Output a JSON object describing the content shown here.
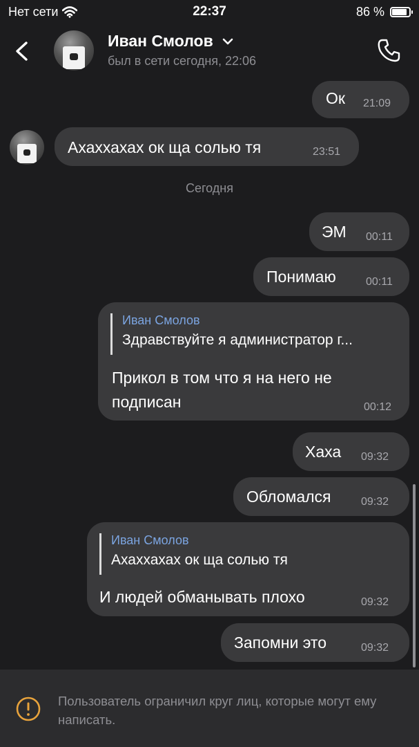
{
  "status_bar": {
    "carrier": "Нет сети",
    "time": "22:37",
    "battery_text": "86 %",
    "battery_level": 0.86,
    "icons": {
      "wifi": "wifi-icon",
      "battery": "battery-icon"
    }
  },
  "header": {
    "name": "Иван Смолов",
    "status": "был в сети сегодня, 22:06",
    "icons": {
      "back": "chevron-left-icon",
      "expand": "chevron-down-icon",
      "call": "phone-icon"
    }
  },
  "messages": [
    {
      "text": "Ок",
      "time": "21:09"
    },
    {
      "text": "Ахаххахах ок ща солью тя",
      "time": "23:51"
    },
    {
      "text": "ЭМ",
      "time": "00:11"
    },
    {
      "text": "Понимаю",
      "time": "00:11"
    },
    {
      "reply_name": "Иван Смолов",
      "reply_text": "Здравствуйте я администратор г...",
      "line1": "Прикол в том что я на него не",
      "line2": "подписан",
      "time": "00:12"
    },
    {
      "text": "Хаха",
      "time": "09:32"
    },
    {
      "text": "Обломался",
      "time": "09:32"
    },
    {
      "reply_name": "Иван Смолов",
      "reply_text": "Ахаххахах ок ща солью тя",
      "text": "И людей обманывать плохо",
      "time": "09:32"
    },
    {
      "text": "Запомни это",
      "time": "09:32"
    }
  ],
  "date_separator": "Сегодня",
  "footer": {
    "notice": "Пользователь ограничил круг лиц, которые могут ему написать.",
    "icon": "warning-icon",
    "accent_color": "#e8a33c"
  },
  "colors": {
    "background": "#1c1c1e",
    "bubble": "#3a3a3c",
    "reply_name": "#7ba4e0",
    "footer_background": "#2c2c2e"
  }
}
